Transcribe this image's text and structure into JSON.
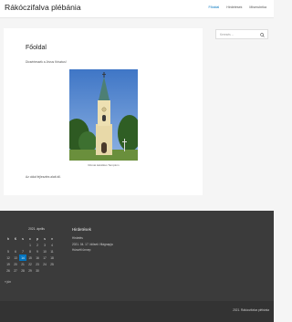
{
  "header": {
    "site_title": "Rákóczifalva plébánia",
    "nav": [
      "Főoldal",
      "Hirdetések",
      "Miserubrika"
    ]
  },
  "main": {
    "title": "Főoldal",
    "intro": "Dicsértessék a Jézus Krisztus!",
    "photo_caption": "Római katolikus Templom",
    "bottom_text": "Az oldal fejlesztés alatt áll."
  },
  "sidebar": {
    "search_placeholder": "Keresés ..."
  },
  "calendar": {
    "caption": "2021. április",
    "weekdays": [
      "h",
      "K",
      "s",
      "c",
      "p",
      "s",
      "v"
    ],
    "weeks": [
      [
        "",
        "",
        "",
        "1",
        "2",
        "3",
        "4"
      ],
      [
        "5",
        "6",
        "7",
        "8",
        "9",
        "10",
        "11"
      ],
      [
        "12",
        "13",
        "14",
        "15",
        "16",
        "17",
        "18"
      ],
      [
        "19",
        "20",
        "21",
        "22",
        "23",
        "24",
        "25"
      ],
      [
        "26",
        "27",
        "28",
        "29",
        "30",
        "",
        ""
      ]
    ],
    "today": "14",
    "prev_link": "« jún"
  },
  "news_widget": {
    "title": "Hirdetések",
    "items": [
      "Hirdetés",
      "2021. 04. 17. Idősek Világnapja",
      "Húsvéti ünnep"
    ]
  },
  "footer": {
    "copyright": "2021. Rákóczifalva plébánia"
  },
  "colors": {
    "accent": "#0274be",
    "footer_bg": "#3b3b3b"
  }
}
